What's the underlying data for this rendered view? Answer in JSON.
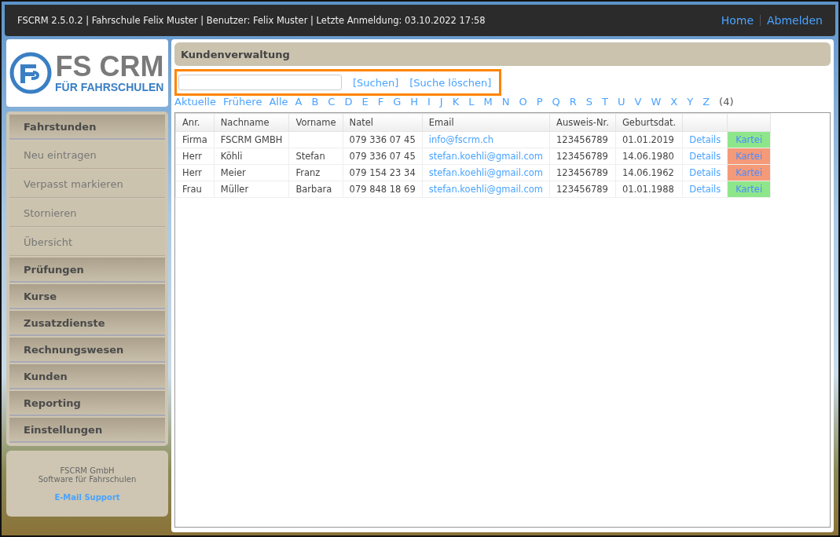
{
  "top_bar": {
    "info": "FSCRM 2.5.0.2 | Fahrschule Felix Muster | Benutzer: Felix Muster | Letzte Anmeldung: 03.10.2022 17:58",
    "links": [
      "Home",
      "Abmelden"
    ]
  },
  "logo": {
    "name": "FS CRM",
    "tagline": "FÜR FAHRSCHULEN"
  },
  "sidebar": {
    "items": [
      {
        "label": "Fahrstunden",
        "kind": "section"
      },
      {
        "label": "Neu eintragen",
        "kind": "item"
      },
      {
        "label": "Verpasst markieren",
        "kind": "item"
      },
      {
        "label": "Stornieren",
        "kind": "item"
      },
      {
        "label": "Übersicht",
        "kind": "item"
      },
      {
        "label": "Prüfungen",
        "kind": "section"
      },
      {
        "label": "Kurse",
        "kind": "section"
      },
      {
        "label": "Zusatzdienste",
        "kind": "section"
      },
      {
        "label": "Rechnungswesen",
        "kind": "section"
      },
      {
        "label": "Kunden",
        "kind": "section"
      },
      {
        "label": "Reporting",
        "kind": "section"
      },
      {
        "label": "Einstellungen",
        "kind": "section"
      }
    ],
    "footer": {
      "company": "FSCRM GmbH",
      "subtitle": "Software für Fahrschulen",
      "link": "E-Mail Support"
    }
  },
  "panel": {
    "title": "Kundenverwaltung",
    "search": {
      "buttons": [
        "[Suchen]",
        "[Suche löschen]"
      ]
    },
    "filters": [
      "Aktuelle",
      "Frühere",
      "Alle",
      "A",
      "B",
      "C",
      "D",
      "E",
      "F",
      "G",
      "H",
      "I",
      "J",
      "K",
      "L",
      "M",
      "N",
      "O",
      "P",
      "Q",
      "R",
      "S",
      "T",
      "U",
      "V",
      "W",
      "X",
      "Y",
      "Z"
    ],
    "count": "(4)",
    "table": {
      "columns": [
        "Anr.",
        "Nachname",
        "Vorname",
        "Natel",
        "Email",
        "Ausweis-Nr.",
        "Geburtsdat."
      ],
      "rows": [
        {
          "cells": [
            "Firma",
            "FSCRM GMBH",
            "",
            "079 336 07 45",
            "info@fscrm.ch",
            "123456789",
            "01.01.2019"
          ],
          "details": "Details",
          "kartei": "Kartei",
          "color": "#8ee68a"
        },
        {
          "cells": [
            "Herr",
            "Köhli",
            "Stefan",
            "079 336 07 45",
            "stefan.koehli@gmail.com",
            "123456789",
            "14.06.1980"
          ],
          "details": "Details",
          "kartei": "Kartei",
          "color": "#f59a78"
        },
        {
          "cells": [
            "Herr",
            "Meier",
            "Franz",
            "079 154 23 34",
            "stefan.koehli@gmail.com",
            "123456789",
            "14.06.1962"
          ],
          "details": "Details",
          "kartei": "Kartei",
          "color": "#f59a78"
        },
        {
          "cells": [
            "Frau",
            "Müller",
            "Barbara",
            "079 848 18 69",
            "stefan.koehli@gmail.com",
            "123456789",
            "01.01.1988"
          ],
          "details": "Details",
          "kartei": "Kartei",
          "color": "#8ee68a"
        }
      ]
    }
  }
}
